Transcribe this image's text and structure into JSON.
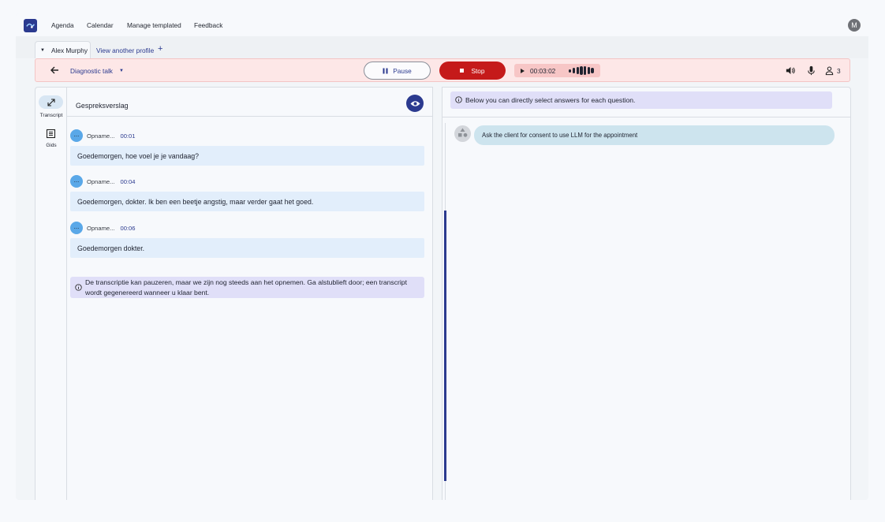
{
  "nav": {
    "items": [
      "Agenda",
      "Calendar",
      "Manage templated",
      "Feedback"
    ],
    "avatar_initial": "M"
  },
  "tabs": {
    "active_profile": "Alex Murphy",
    "other_profile_link": "View another profile",
    "add_symbol": "+"
  },
  "session": {
    "talk_type": "Diagnostic talk",
    "pause_label": "Pause",
    "stop_label": "Stop",
    "elapsed": "00:03:02",
    "participants": "3",
    "status_color": "#c51a1a"
  },
  "rail": {
    "transcript_label": "Transcript",
    "guide_label": "Gids"
  },
  "transcript": {
    "title": "Gespreksverslag",
    "messages": [
      {
        "avatar": "...",
        "speaker": "Opname...",
        "time": "00:01",
        "text": "Goedemorgen, hoe voel je je vandaag?"
      },
      {
        "avatar": "...",
        "speaker": "Opname...",
        "time": "00:04",
        "text": "Goedemorgen, dokter. Ik ben een beetje angstig, maar verder gaat het goed."
      },
      {
        "avatar": "...",
        "speaker": "Opname...",
        "time": "00:06",
        "text": "Goedemorgen dokter."
      }
    ],
    "notice": "De transcriptie kan pauzeren, maar we zijn nog steeds aan het opnemen. Ga alstublieft door; een transcript wordt gegenereerd wanneer u klaar bent."
  },
  "questions": {
    "hint": "Below you can directly select answers for each question.",
    "items": [
      {
        "text": "Ask the client for consent to use LLM for the appointment"
      }
    ]
  }
}
